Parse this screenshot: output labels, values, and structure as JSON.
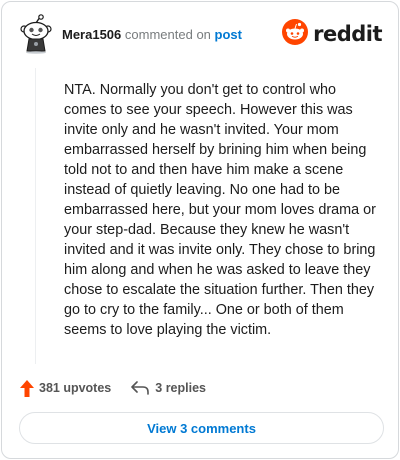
{
  "header": {
    "username": "Mera1506",
    "action_text": "commented on",
    "post_link": "post",
    "brand_name": "reddit"
  },
  "comment": {
    "body": "NTA. Normally you don't get to control who comes to see your speech. However this was invite only and he wasn't invited. Your mom embarrassed herself by brining him when being told not to and then have him make a scene instead of quietly leaving. No one had to be embarrassed here, but your mom loves drama or your step-dad. Because they knew he wasn't invited and it was invite only. They chose to bring him along and when he was asked to leave they chose to escalate the situation further. Then they go to cry to the family... One or both of them seems to love playing the victim."
  },
  "actions": {
    "upvotes_label": "381 upvotes",
    "replies_label": "3 replies"
  },
  "footer": {
    "view_comments_label": "View 3 comments"
  },
  "icons": {
    "upvote": "upvote-arrow-icon",
    "reply": "reply-arrow-icon",
    "brand": "reddit-alien-logo-icon",
    "avatar": "snoo-avatar-icon"
  },
  "colors": {
    "upvote": "#ff4500",
    "brand_orange": "#ff4500",
    "link_blue": "#0079d3",
    "muted_gray": "#787c7e"
  }
}
